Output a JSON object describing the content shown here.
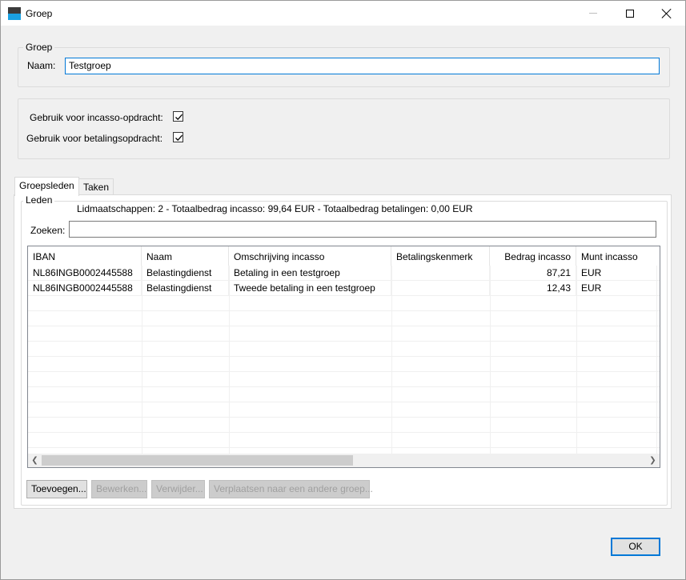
{
  "window": {
    "title": "Groep"
  },
  "group_box": {
    "legend": "Groep",
    "name_label": "Naam:",
    "name_value": "Testgroep"
  },
  "options": {
    "incasso_label": "Gebruik voor incasso-opdracht:",
    "incasso_checked": true,
    "betaling_label": "Gebruik voor betalingsopdracht:",
    "betaling_checked": true
  },
  "tabs": [
    {
      "label": "Groepsleden",
      "active": true
    },
    {
      "label": "Taken",
      "active": false
    }
  ],
  "members": {
    "legend": "Leden",
    "summary": "Lidmaatschappen: 2 - Totaalbedrag incasso: 99,64 EUR - Totaalbedrag betalingen: 0,00 EUR",
    "search_label": "Zoeken:",
    "search_value": "",
    "columns": [
      "IBAN",
      "Naam",
      "Omschrijving incasso",
      "Betalingskenmerk",
      "Bedrag incasso",
      "Munt incasso"
    ],
    "rows": [
      [
        "NL86INGB0002445588",
        "Belastingdienst",
        "Betaling in een testgroep",
        "",
        "87,21",
        "EUR"
      ],
      [
        "NL86INGB0002445588",
        "Belastingdienst",
        "Tweede betaling in een testgroep",
        "",
        "12,43",
        "EUR"
      ]
    ],
    "buttons": {
      "add": "Toevoegen...",
      "edit": "Bewerken...",
      "delete": "Verwijder...",
      "move": "Verplaatsen naar een andere groep..."
    }
  },
  "footer": {
    "ok": "OK"
  },
  "colors": {
    "accent": "#0078d7",
    "icon_dark": "#3b3b3b",
    "icon_blue": "#1ba1e2"
  }
}
